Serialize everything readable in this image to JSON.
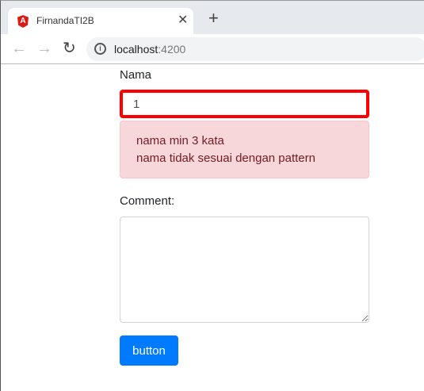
{
  "browser": {
    "tab_title": "FirnandaTI2B",
    "tab_icon": "angular-logo",
    "url_host": "localhost",
    "url_port": ":4200"
  },
  "form": {
    "name_label": "Nama",
    "name_value": "1",
    "errors": [
      "nama min 3 kata",
      "nama tidak sesuai dengan pattern"
    ],
    "comment_label": "Comment:",
    "comment_value": "",
    "button_label": "button"
  },
  "colors": {
    "error_border": "#ff0000",
    "alert_bg": "#f8d7da",
    "alert_text": "#721c24",
    "button": "#007bff"
  }
}
